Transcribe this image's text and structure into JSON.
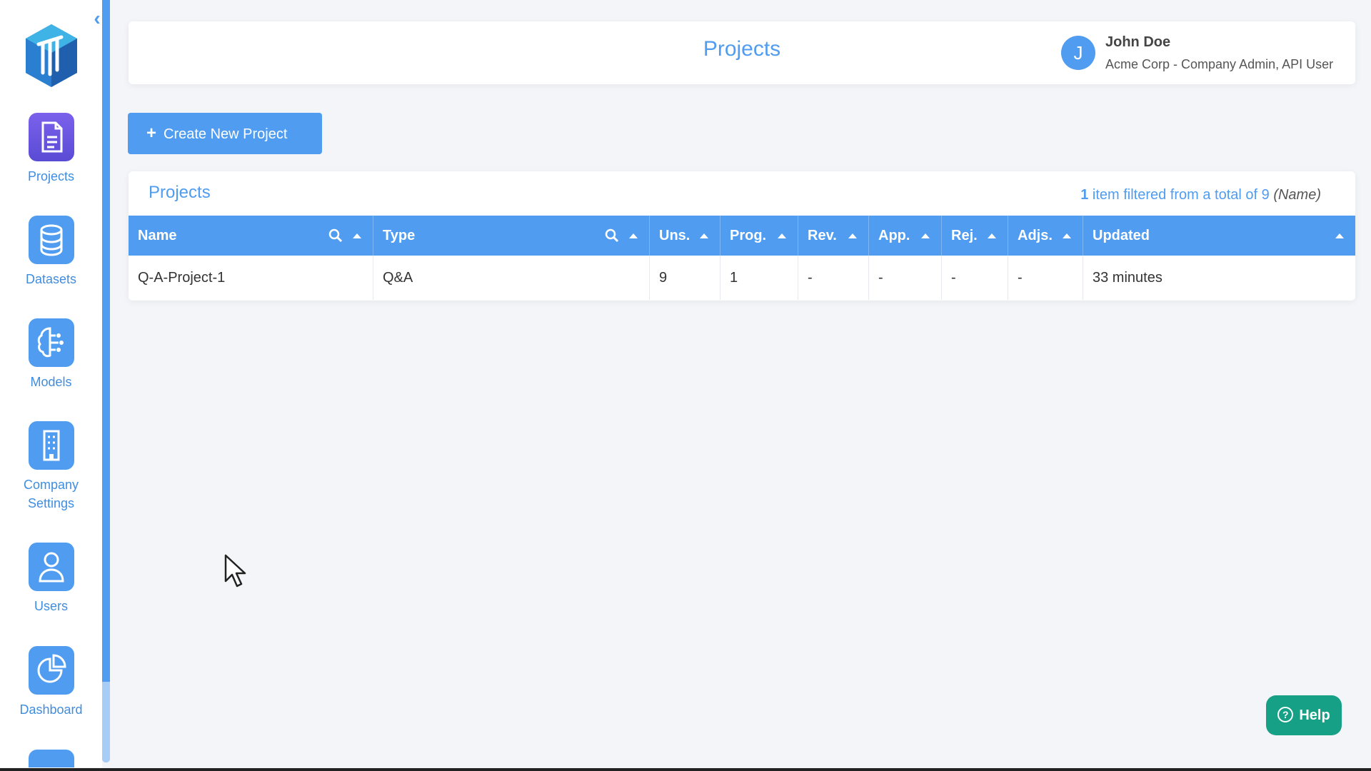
{
  "sidebar": {
    "items": [
      {
        "label": "Projects",
        "icon": "document-icon",
        "active": true
      },
      {
        "label": "Datasets",
        "icon": "database-icon",
        "active": false
      },
      {
        "label": "Models",
        "icon": "brain-icon",
        "active": false
      },
      {
        "label": "Company Settings",
        "icon": "building-icon",
        "active": false
      },
      {
        "label": "Users",
        "icon": "user-icon",
        "active": false
      },
      {
        "label": "Dashboard",
        "icon": "pie-chart-icon",
        "active": false
      }
    ],
    "collapse_glyph": "‹"
  },
  "header": {
    "title": "Projects",
    "avatar_initial": "J",
    "user_name": "John Doe",
    "user_role": "Acme Corp - Company Admin, API User"
  },
  "toolbar": {
    "create_label": "Create New Project"
  },
  "table": {
    "title": "Projects",
    "filter_count": "1",
    "filter_text": " item filtered from a total of 9 ",
    "filter_by": "(Name)",
    "columns": [
      {
        "label": "Name",
        "searchable": true
      },
      {
        "label": "Type",
        "searchable": true
      },
      {
        "label": "Uns.",
        "searchable": false
      },
      {
        "label": "Prog.",
        "searchable": false
      },
      {
        "label": "Rev.",
        "searchable": false
      },
      {
        "label": "App.",
        "searchable": false
      },
      {
        "label": "Rej.",
        "searchable": false
      },
      {
        "label": "Adjs.",
        "searchable": false
      },
      {
        "label": "Updated",
        "searchable": false
      }
    ],
    "rows": [
      [
        "Q-A-Project-1",
        "Q&A",
        "9",
        "1",
        "-",
        "-",
        "-",
        "-",
        "33 minutes"
      ]
    ]
  },
  "help": {
    "label": "Help"
  },
  "colors": {
    "accent": "#4f9cf0",
    "active_nav": "#6c5ce7",
    "help": "#16a085"
  }
}
